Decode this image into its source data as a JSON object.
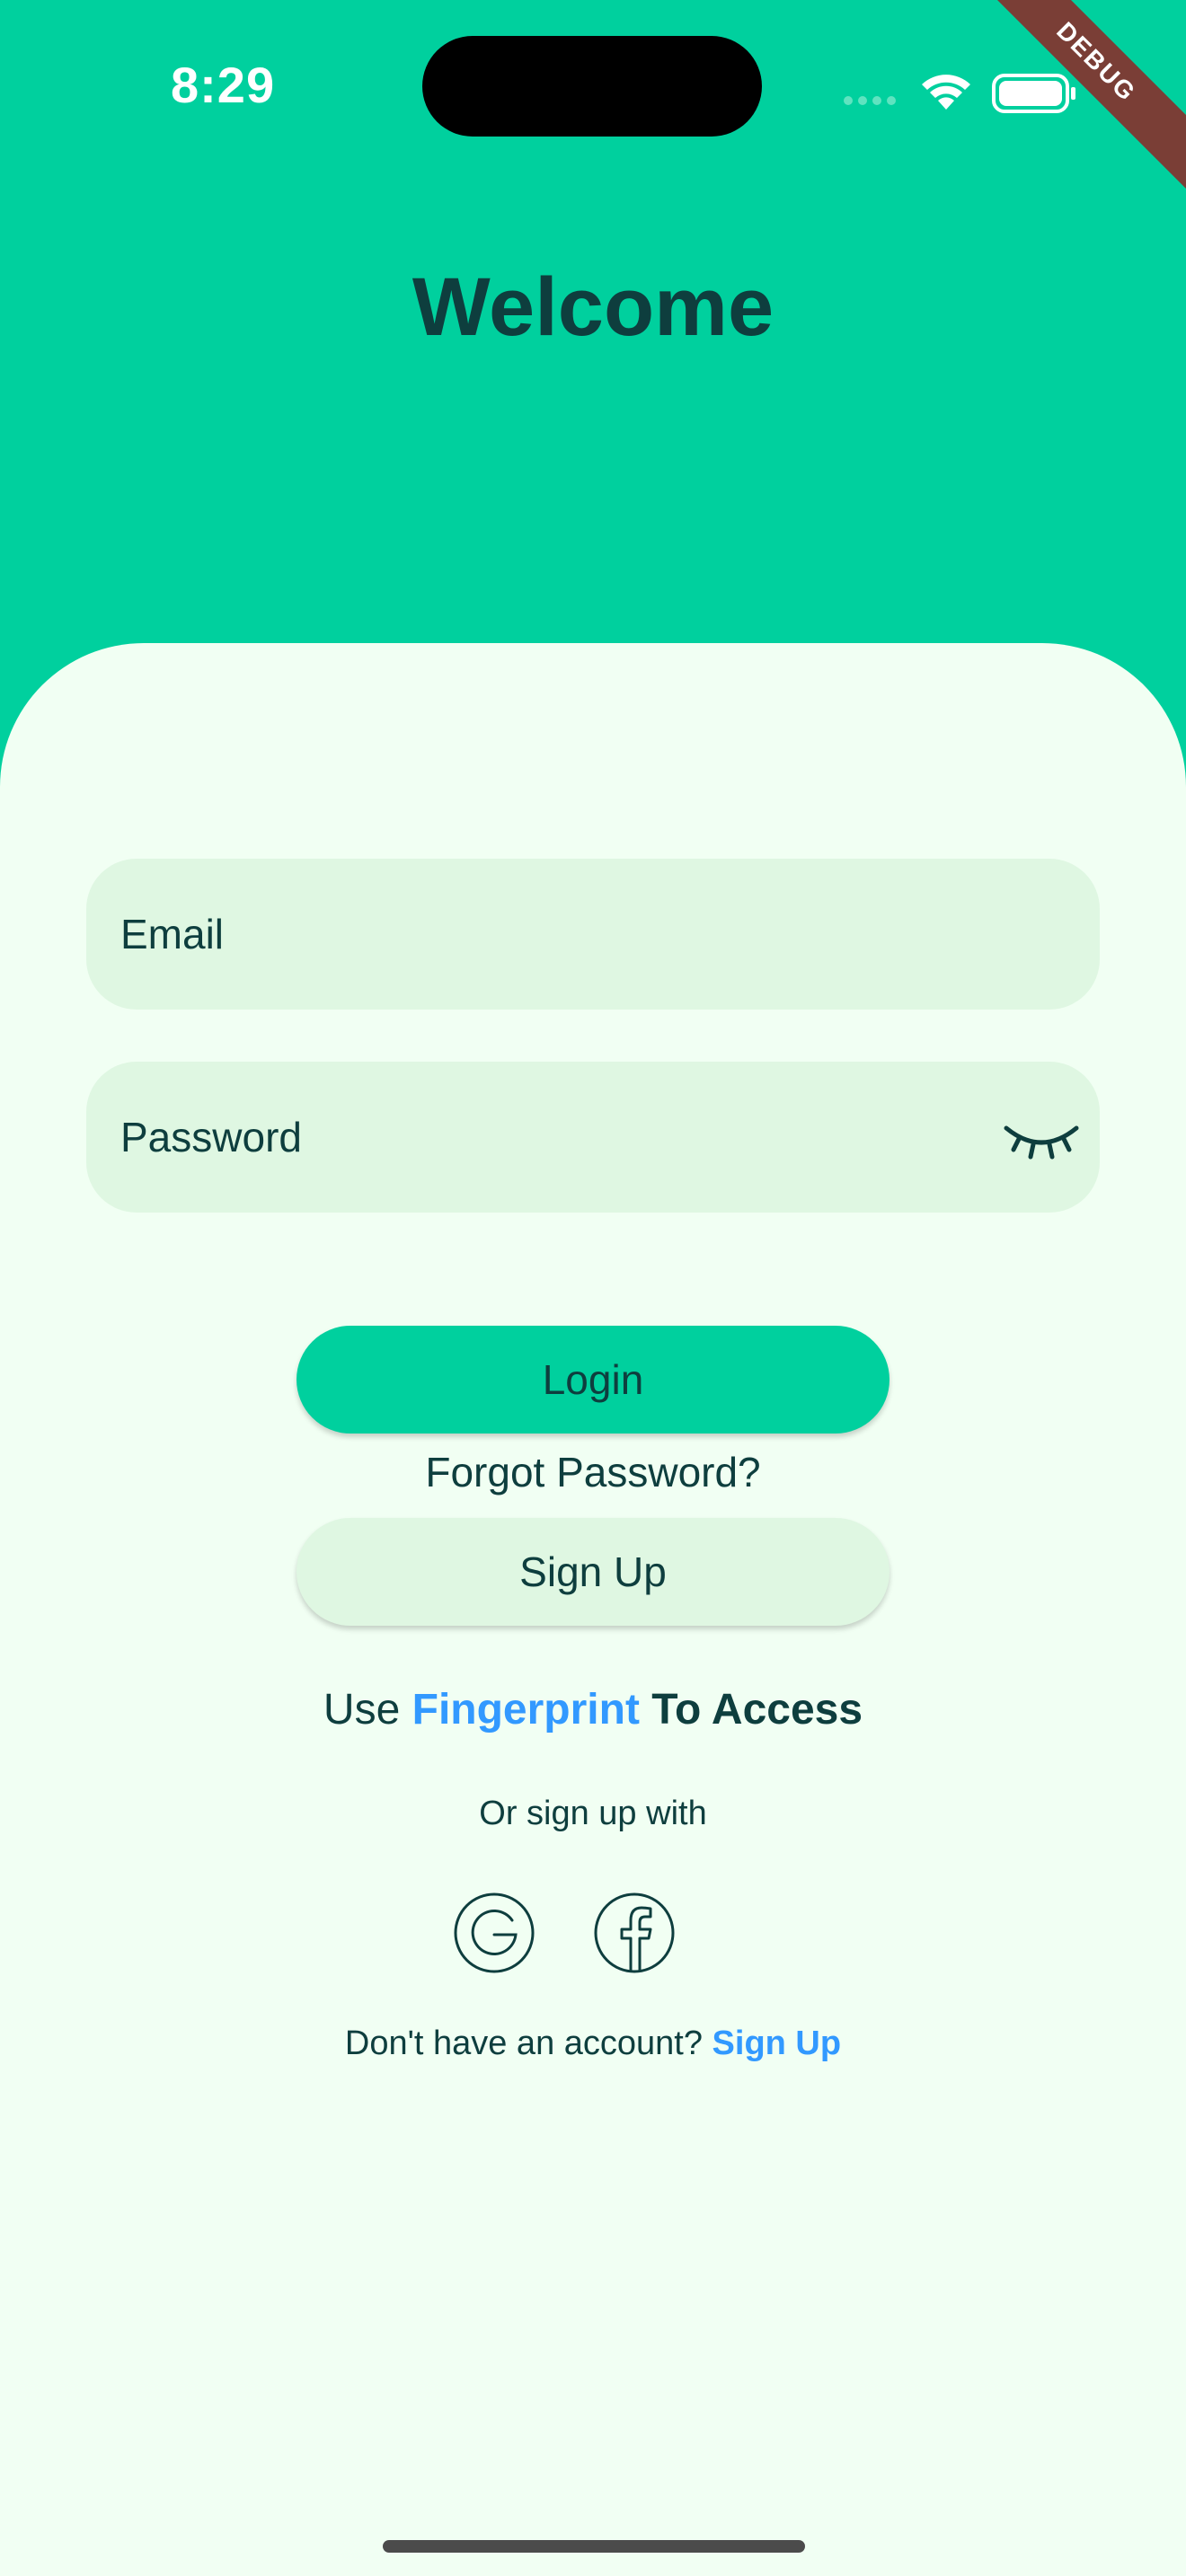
{
  "status_bar": {
    "time": "8:29"
  },
  "debug_banner": "DEBUG",
  "header": {
    "title": "Welcome"
  },
  "form": {
    "email_placeholder": "Email",
    "password_placeholder": "Password"
  },
  "actions": {
    "login_label": "Login",
    "forgot_password_label": "Forgot Password?",
    "signup_label": "Sign Up"
  },
  "fingerprint": {
    "prefix": "Use",
    "highlight": "Fingerprint",
    "suffix": "To Access"
  },
  "social": {
    "label": "Or sign up with",
    "providers": [
      "google-icon",
      "facebook-icon"
    ]
  },
  "footer": {
    "question": "Don't have an account?",
    "link": "Sign Up"
  },
  "colors": {
    "header_bg": "#00D09E",
    "card_bg": "#F1FFF3",
    "field_bg": "#DFF7E2",
    "text": "#0E3E3E",
    "link": "#3299FF"
  }
}
